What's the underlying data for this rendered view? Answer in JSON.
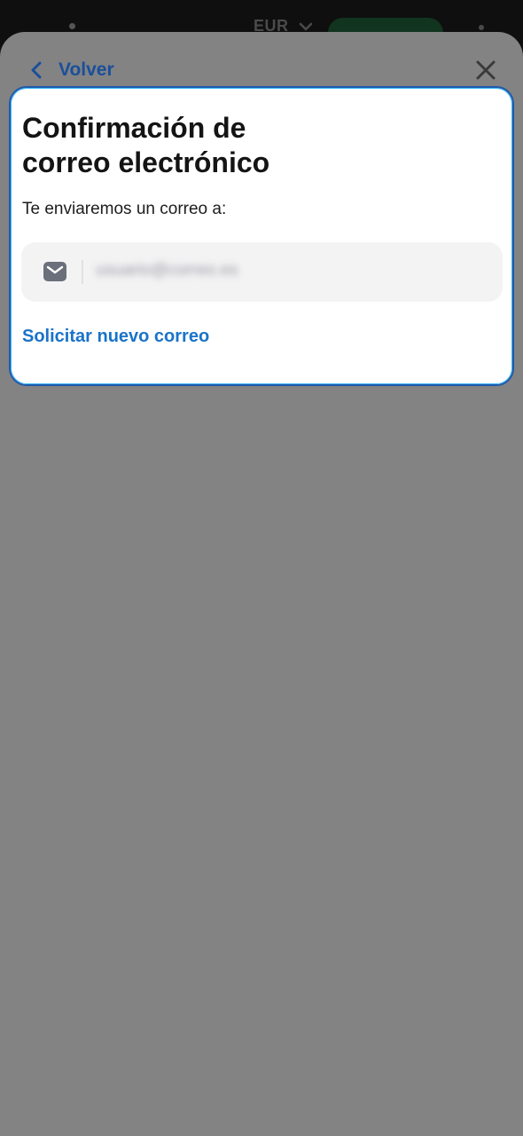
{
  "background": {
    "currency": "EUR"
  },
  "header": {
    "back_label": "Volver"
  },
  "card": {
    "title_line1": "Confirmación de",
    "title_line2": "correo electrónico",
    "description": "Te enviaremos un correo a:",
    "email": "usuario@correo.es",
    "resend_label": "Solicitar nuevo correo"
  },
  "colors": {
    "overlay": "#838383",
    "link": "#1a73c9",
    "back": "#1a4f9a",
    "card_border": "#1f5aa8"
  },
  "icons": {
    "back": "chevron-left-icon",
    "close": "close-icon",
    "email": "mail-icon",
    "currency": "chevron-down-icon"
  }
}
